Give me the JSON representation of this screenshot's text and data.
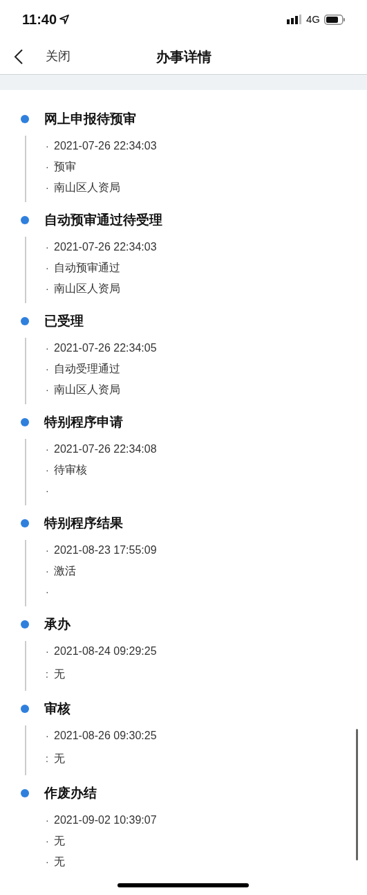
{
  "status_bar": {
    "time": "11:40",
    "network": "4G"
  },
  "nav": {
    "close": "关闭",
    "title": "办事详情"
  },
  "steps": [
    {
      "title": "网上申报待预审",
      "lines": [
        {
          "bullet": "·",
          "text": "2021-07-26 22:34:03"
        },
        {
          "bullet": "·",
          "text": "预审"
        },
        {
          "bullet": "·",
          "text": "南山区人资局"
        }
      ]
    },
    {
      "title": "自动预审通过待受理",
      "lines": [
        {
          "bullet": "·",
          "text": "2021-07-26 22:34:03"
        },
        {
          "bullet": "·",
          "text": "自动预审通过"
        },
        {
          "bullet": "·",
          "text": "南山区人资局"
        }
      ]
    },
    {
      "title": "已受理",
      "lines": [
        {
          "bullet": "·",
          "text": "2021-07-26 22:34:05"
        },
        {
          "bullet": "·",
          "text": "自动受理通过"
        },
        {
          "bullet": "·",
          "text": "南山区人资局"
        }
      ]
    },
    {
      "title": "特别程序申请",
      "lines": [
        {
          "bullet": "·",
          "text": "2021-07-26 22:34:08"
        },
        {
          "bullet": "·",
          "text": "待审核"
        },
        {
          "bullet": "·"
        }
      ]
    },
    {
      "title": "特别程序结果",
      "lines": [
        {
          "bullet": "·",
          "text": "2021-08-23 17:55:09"
        },
        {
          "bullet": "·",
          "text": "激活"
        },
        {
          "bullet": "·"
        }
      ]
    },
    {
      "title": "承办",
      "lines": [
        {
          "bullet": "·",
          "text": "2021-08-24 09:29:25"
        },
        {
          "bullet": ":",
          "text": "无"
        }
      ]
    },
    {
      "title": "审核",
      "lines": [
        {
          "bullet": "·",
          "text": "2021-08-26 09:30:25"
        },
        {
          "bullet": ":",
          "text": "无"
        }
      ]
    },
    {
      "title": "作废办结",
      "lines": [
        {
          "bullet": "·",
          "text": "2021-09-02 10:39:07"
        },
        {
          "bullet": "·",
          "text": "无"
        },
        {
          "bullet": "·",
          "text": "无"
        }
      ]
    }
  ]
}
